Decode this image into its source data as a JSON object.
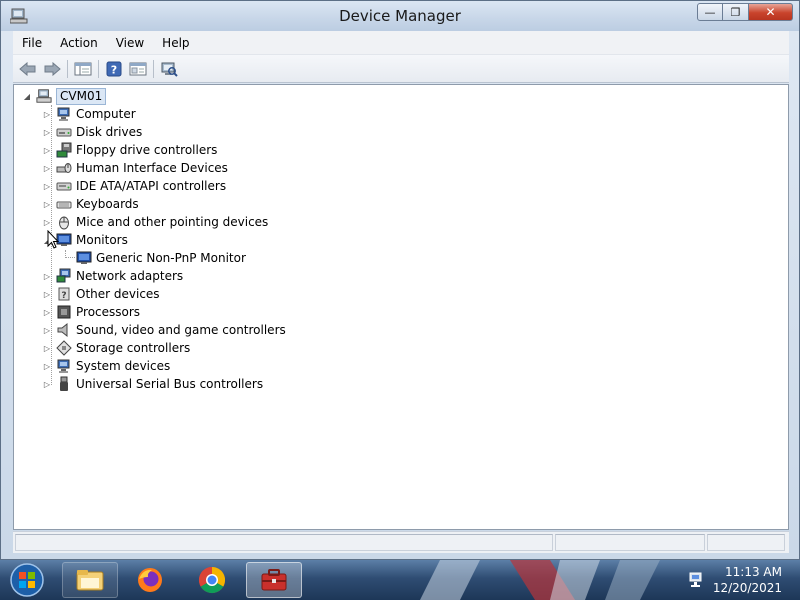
{
  "window": {
    "title": "Device Manager"
  },
  "menu": [
    "File",
    "Action",
    "View",
    "Help"
  ],
  "toolbar": {
    "buttons": [
      "back-arrow-icon",
      "forward-arrow-icon",
      "show-hide-console-tree-icon",
      "help-icon",
      "properties-icon",
      "scan-hardware-icon"
    ]
  },
  "tree": {
    "root": "CVM01",
    "categories": [
      {
        "label": "Computer",
        "icon": "computer-icon",
        "expanded": false
      },
      {
        "label": "Disk drives",
        "icon": "disk-drive-icon",
        "expanded": false
      },
      {
        "label": "Floppy drive controllers",
        "icon": "floppy-controller-icon",
        "expanded": false
      },
      {
        "label": "Human Interface Devices",
        "icon": "hid-icon",
        "expanded": false
      },
      {
        "label": "IDE ATA/ATAPI controllers",
        "icon": "ide-controller-icon",
        "expanded": false
      },
      {
        "label": "Keyboards",
        "icon": "keyboard-icon",
        "expanded": false
      },
      {
        "label": "Mice and other pointing devices",
        "icon": "mouse-icon",
        "expanded": false
      },
      {
        "label": "Monitors",
        "icon": "monitor-icon",
        "expanded": true,
        "children": [
          "Generic Non-PnP Monitor"
        ]
      },
      {
        "label": "Network adapters",
        "icon": "network-adapter-icon",
        "expanded": false
      },
      {
        "label": "Other devices",
        "icon": "other-devices-icon",
        "expanded": false
      },
      {
        "label": "Processors",
        "icon": "processor-icon",
        "expanded": false
      },
      {
        "label": "Sound, video and game controllers",
        "icon": "sound-icon",
        "expanded": false
      },
      {
        "label": "Storage controllers",
        "icon": "storage-controller-icon",
        "expanded": false
      },
      {
        "label": "System devices",
        "icon": "system-devices-icon",
        "expanded": false
      },
      {
        "label": "Universal Serial Bus controllers",
        "icon": "usb-icon",
        "expanded": false
      }
    ]
  },
  "taskbar": {
    "apps": [
      "windows-explorer-icon",
      "firefox-icon",
      "chrome-icon",
      "device-manager-icon"
    ],
    "time": "11:13 AM",
    "date": "12/20/2021"
  },
  "colors": {
    "selection": "#dbe7f5",
    "taskbar": "#2f4d73",
    "close_button": "#c9442c"
  }
}
